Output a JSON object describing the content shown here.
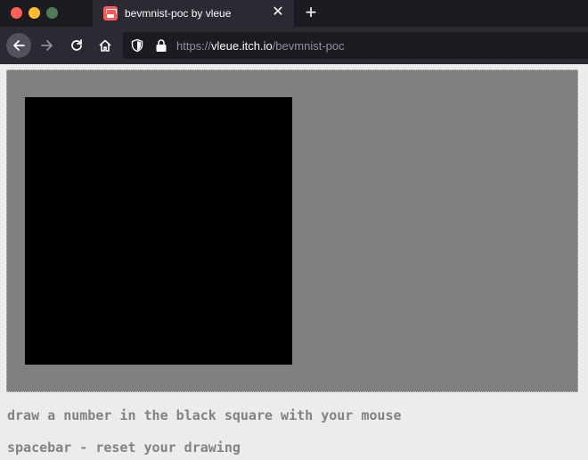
{
  "browser": {
    "tab": {
      "title": "bevmnist-poc by vleue",
      "favicon": "itch-io-icon"
    },
    "url": {
      "scheme": "https://",
      "host": "vleue.itch.io",
      "path": "/bevmnist-poc"
    }
  },
  "page": {
    "instructions": [
      "draw a number in the black square with your mouse",
      "spacebar - reset your drawing"
    ]
  },
  "colors": {
    "frame": "#808080",
    "canvas": "#000000",
    "instruction_text": "#828282"
  }
}
